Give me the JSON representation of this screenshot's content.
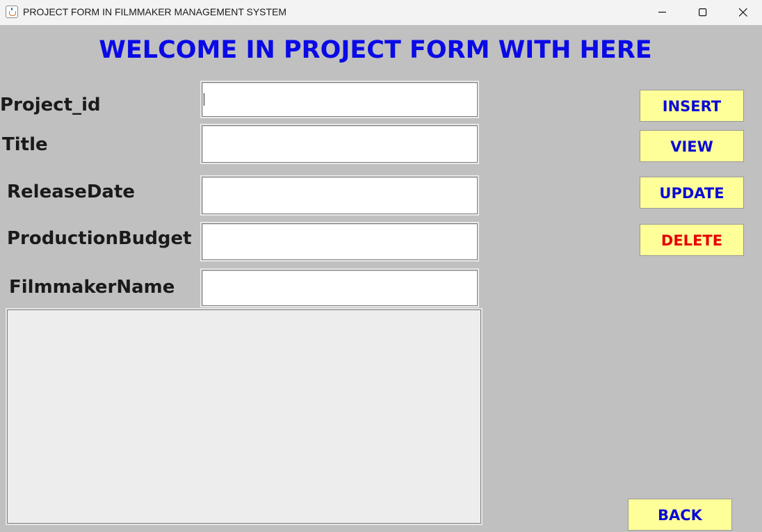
{
  "window": {
    "title": "PROJECT FORM IN FILMMAKER MANAGEMENT SYSTEM",
    "icon": "java-cup-icon",
    "controls": [
      "minimize-icon",
      "maximize-icon",
      "close-icon"
    ]
  },
  "heading": "WELCOME IN PROJECT FORM WITH HERE",
  "form": {
    "project_id": {
      "label": "Project_id",
      "value": ""
    },
    "title": {
      "label": "Title",
      "value": ""
    },
    "release_date": {
      "label": "ReleaseDate",
      "value": ""
    },
    "production_budget": {
      "label": "ProductionBudget",
      "value": ""
    },
    "filmmaker_name": {
      "label": "FilmmakerName",
      "value": ""
    }
  },
  "output_area": {
    "value": ""
  },
  "buttons": {
    "insert": "INSERT",
    "view": "VIEW",
    "update": "UPDATE",
    "delete": "DELETE",
    "back": "BACK"
  },
  "colors": {
    "background": "#c0c0c0",
    "heading": "#0a0ae6",
    "button_bg": "#ffff99",
    "button_text": "#0a0ad6",
    "delete_text": "#e60000",
    "output_bg": "#ededed"
  }
}
